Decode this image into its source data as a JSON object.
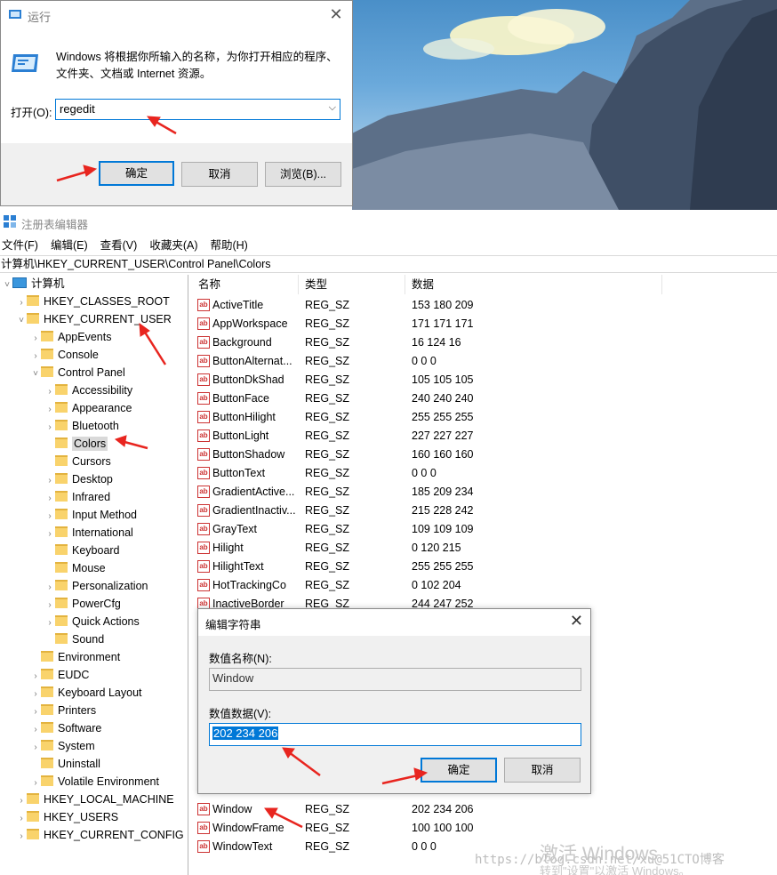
{
  "run_dialog": {
    "title": "运行",
    "close": "✕",
    "description": "Windows 将根据你所输入的名称，为你打开相应的程序、文件夹、文档或 Internet 资源。",
    "open_label": "打开(O):",
    "command_value": "regedit",
    "ok_label": "确定",
    "cancel_label": "取消",
    "browse_label": "浏览(B)..."
  },
  "regedit": {
    "title": "注册表编辑器",
    "menu": [
      "文件(F)",
      "编辑(E)",
      "查看(V)",
      "收藏夹(A)",
      "帮助(H)"
    ],
    "address": "计算机\\HKEY_CURRENT_USER\\Control Panel\\Colors",
    "tree": {
      "root": "计算机",
      "hives_top": [
        "HKEY_CLASSES_ROOT",
        "HKEY_CURRENT_USER"
      ],
      "hkcu_children_top": [
        "AppEvents",
        "Console",
        "Control Panel"
      ],
      "control_panel_children": [
        "Accessibility",
        "Appearance",
        "Bluetooth",
        "Colors",
        "Cursors",
        "Desktop",
        "Infrared",
        "Input Method",
        "International",
        "Keyboard",
        "Mouse",
        "Personalization",
        "PowerCfg",
        "Quick Actions",
        "Sound"
      ],
      "hkcu_children_bottom": [
        "Environment",
        "EUDC",
        "Keyboard Layout",
        "Printers",
        "Software",
        "System",
        "Uninstall",
        "Volatile Environment"
      ],
      "hives_bottom": [
        "HKEY_LOCAL_MACHINE",
        "HKEY_USERS",
        "HKEY_CURRENT_CONFIG"
      ],
      "selected": "Colors"
    },
    "columns": [
      "名称",
      "类型",
      "数据"
    ],
    "values_top": [
      {
        "name": "ActiveTitle",
        "type": "REG_SZ",
        "data": "153 180 209"
      },
      {
        "name": "AppWorkspace",
        "type": "REG_SZ",
        "data": "171 171 171"
      },
      {
        "name": "Background",
        "type": "REG_SZ",
        "data": "16 124 16"
      },
      {
        "name": "ButtonAlternat...",
        "type": "REG_SZ",
        "data": "0 0 0"
      },
      {
        "name": "ButtonDkShad",
        "type": "REG_SZ",
        "data": "105 105 105"
      },
      {
        "name": "ButtonFace",
        "type": "REG_SZ",
        "data": "240 240 240"
      },
      {
        "name": "ButtonHilight",
        "type": "REG_SZ",
        "data": "255 255 255"
      },
      {
        "name": "ButtonLight",
        "type": "REG_SZ",
        "data": "227 227 227"
      },
      {
        "name": "ButtonShadow",
        "type": "REG_SZ",
        "data": "160 160 160"
      },
      {
        "name": "ButtonText",
        "type": "REG_SZ",
        "data": "0 0 0"
      },
      {
        "name": "GradientActive...",
        "type": "REG_SZ",
        "data": "185 209 234"
      },
      {
        "name": "GradientInactiv...",
        "type": "REG_SZ",
        "data": "215 228 242"
      },
      {
        "name": "GrayText",
        "type": "REG_SZ",
        "data": "109 109 109"
      },
      {
        "name": "Hilight",
        "type": "REG_SZ",
        "data": "0 120 215"
      },
      {
        "name": "HilightText",
        "type": "REG_SZ",
        "data": "255 255 255"
      },
      {
        "name": "HotTrackingCo",
        "type": "REG_SZ",
        "data": "0 102 204"
      },
      {
        "name": "InactiveBorder",
        "type": "REG_SZ",
        "data": "244 247 252"
      }
    ],
    "values_bottom": [
      {
        "name": "Window",
        "type": "REG_SZ",
        "data": "202 234 206"
      },
      {
        "name": "WindowFrame",
        "type": "REG_SZ",
        "data": "100 100 100"
      },
      {
        "name": "WindowText",
        "type": "REG_SZ",
        "data": "0 0 0"
      }
    ]
  },
  "edit_string": {
    "title": "编辑字符串",
    "close": "✕",
    "name_label": "数值名称(N):",
    "name_value": "Window",
    "data_label": "数值数据(V):",
    "data_value": "202 234 206",
    "ok_label": "确定",
    "cancel_label": "取消"
  },
  "watermark": {
    "activate": "激活 Windows",
    "activate_sub": "转到\"设置\"以激活 Windows。",
    "url": "https://blog.csdn.net/xu@51CTO博客"
  },
  "colors": {
    "accent": "#0078d7",
    "arrow": "#e8251f",
    "folder": "#f9d36c",
    "selection": "#d9d9d9"
  }
}
